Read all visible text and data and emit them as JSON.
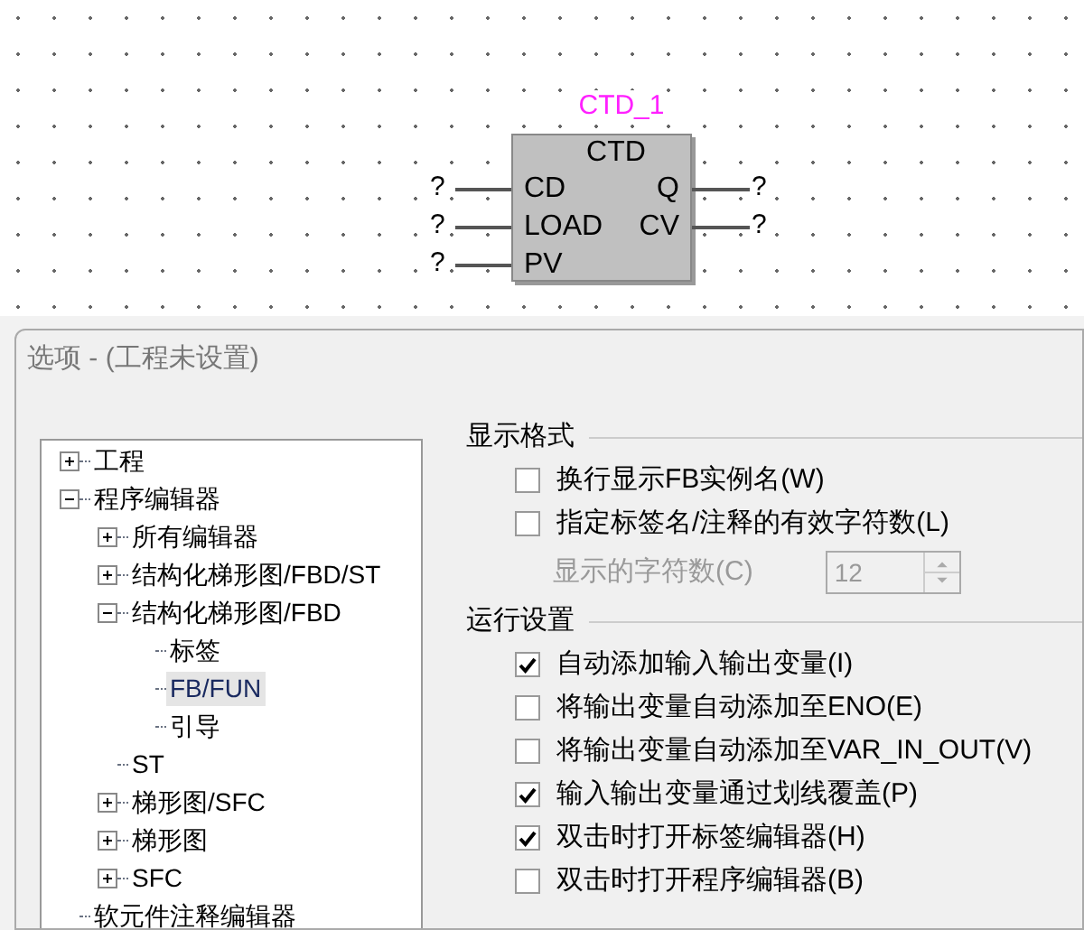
{
  "diagram": {
    "instance": "CTD_1",
    "type": "CTD",
    "inputs": [
      {
        "pin": "CD",
        "value": "?"
      },
      {
        "pin": "LOAD",
        "value": "?"
      },
      {
        "pin": "PV",
        "value": "?"
      }
    ],
    "outputs": [
      {
        "pin": "Q",
        "value": "?"
      },
      {
        "pin": "CV",
        "value": "?"
      }
    ]
  },
  "dialog": {
    "title": "选项 - (工程未设置)"
  },
  "tree": [
    {
      "label": "工程",
      "expanded": false,
      "selected": false
    },
    {
      "label": "程序编辑器",
      "expanded": true,
      "selected": false,
      "children": [
        {
          "label": "所有编辑器",
          "expanded": false,
          "selected": false
        },
        {
          "label": "结构化梯形图/FBD/ST",
          "expanded": false,
          "selected": false
        },
        {
          "label": "结构化梯形图/FBD",
          "expanded": true,
          "selected": false,
          "children": [
            {
              "label": "标签",
              "selected": false
            },
            {
              "label": "FB/FUN",
              "selected": true
            },
            {
              "label": "引导",
              "selected": false
            }
          ]
        },
        {
          "label": "ST",
          "selected": false
        },
        {
          "label": "梯形图/SFC",
          "expanded": false,
          "selected": false
        },
        {
          "label": "梯形图",
          "expanded": false,
          "selected": false
        },
        {
          "label": "SFC",
          "expanded": false,
          "selected": false
        }
      ]
    },
    {
      "label": "软元件注释编辑器",
      "selected": false
    }
  ],
  "display_format": {
    "title": "显示格式",
    "options": [
      {
        "label": "换行显示FB实例名(W)",
        "checked": false
      },
      {
        "label": "指定标签名/注释的有效字符数(L)",
        "checked": false
      }
    ],
    "char_count": {
      "label": "显示的字符数(C)",
      "value": "12",
      "disabled": true
    }
  },
  "run_settings": {
    "title": "运行设置",
    "options": [
      {
        "label": "自动添加输入输出变量(I)",
        "checked": true
      },
      {
        "label": "将输出变量自动添加至ENO(E)",
        "checked": false
      },
      {
        "label": "将输出变量自动添加至VAR_IN_OUT(V)",
        "checked": false
      },
      {
        "label": "输入输出变量通过划线覆盖(P)",
        "checked": true
      },
      {
        "label": "双击时打开标签编辑器(H)",
        "checked": true
      },
      {
        "label": "双击时打开程序编辑器(B)",
        "checked": false
      }
    ]
  }
}
